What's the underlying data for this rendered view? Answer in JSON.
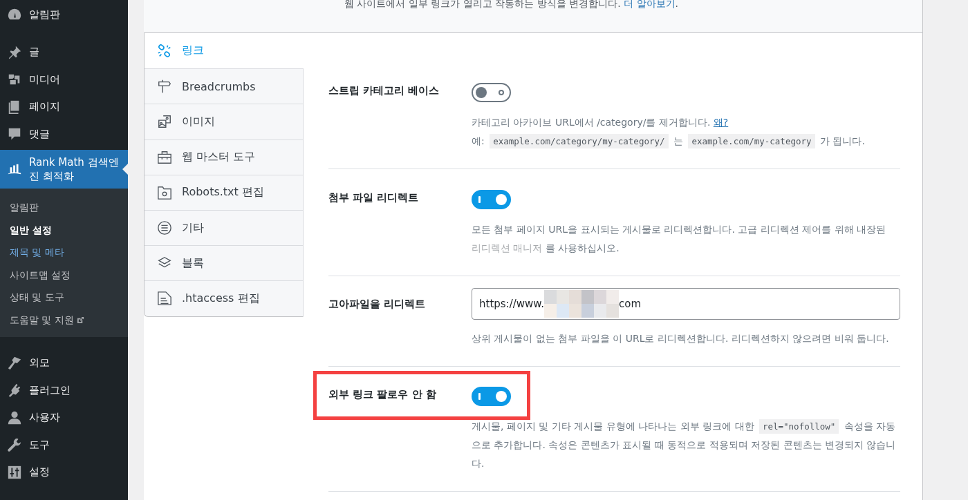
{
  "sidebar": {
    "items": [
      {
        "label": "알림판",
        "selected": false
      },
      {
        "label": "글",
        "selected": false
      },
      {
        "label": "미디어",
        "selected": false
      },
      {
        "label": "페이지",
        "selected": false
      },
      {
        "label": "댓글",
        "selected": false
      },
      {
        "label": "Rank Math 검색엔진 최적화",
        "selected": true,
        "children": [
          {
            "label": "알림판",
            "selected": false,
            "current": false
          },
          {
            "label": "일반 설정",
            "selected": true,
            "current": false
          },
          {
            "label": "제목 및 메타",
            "selected": false,
            "current": true
          },
          {
            "label": "사이트맵 설정",
            "selected": false,
            "current": false
          },
          {
            "label": "상태 및 도구",
            "selected": false,
            "current": false
          },
          {
            "label": "도움말 및 지원",
            "selected": false,
            "current": false,
            "external": true
          }
        ]
      },
      {
        "label": "외모",
        "selected": false
      },
      {
        "label": "플러그인",
        "selected": false
      },
      {
        "label": "사용자",
        "selected": false
      },
      {
        "label": "도구",
        "selected": false
      },
      {
        "label": "설정",
        "selected": false
      }
    ]
  },
  "header": {
    "description": "웹 사이트에서 일부 링크가 열리고 작동하는 방식을 변경합니다.",
    "link": "더 알아보기",
    "end": "."
  },
  "tabs": [
    {
      "label": "링크",
      "selected": true
    },
    {
      "label": "Breadcrumbs",
      "selected": false
    },
    {
      "label": "이미지",
      "selected": false
    },
    {
      "label": "웹 마스터 도구",
      "selected": false
    },
    {
      "label": "Robots.txt 편집",
      "selected": false
    },
    {
      "label": "기타",
      "selected": false
    },
    {
      "label": "블록",
      "selected": false
    },
    {
      "label": ".htaccess 편집",
      "selected": false
    }
  ],
  "settings": [
    {
      "label": "스트립 카테고리 베이스",
      "kind": "toggle",
      "on": false,
      "highlighted": false,
      "description": [
        [
          {
            "kind": "text",
            "text": "카테고리 아카이브 URL에서 /category/를 제거합니다."
          },
          {
            "kind": "link",
            "text": "왜?"
          }
        ],
        [
          {
            "kind": "text",
            "text": "예:"
          },
          {
            "kind": "code",
            "text": "example.com/category/my-category/"
          },
          {
            "kind": "text",
            "text": "는"
          },
          {
            "kind": "code",
            "text": "example.com/my-category"
          },
          {
            "kind": "text",
            "text": "가 됩니다."
          }
        ]
      ]
    },
    {
      "label": "첨부 파일 리디렉트",
      "kind": "toggle",
      "on": true,
      "highlighted": false,
      "description": [
        [
          {
            "kind": "text",
            "text": "모든 첨부 페이지 URL을 표시되는 게시물로 리디렉션합니다. 고급 리디렉션 제어를 위해 내장된 "
          },
          {
            "kind": "muted-link",
            "text": "리디렉션 매니저"
          },
          {
            "kind": "text",
            "text": "를 사용하십시오."
          }
        ]
      ]
    },
    {
      "label": "고아파일을 리디렉트",
      "kind": "field",
      "value": "https://www.",
      "value_end": "com",
      "highlighted": false,
      "description": [
        [
          {
            "kind": "text",
            "text": "상위 게시물이 없는 첨부 파일을 이 URL로 리디렉션합니다. 리디렉션하지 않으려면 비워 둡니다."
          }
        ]
      ]
    },
    {
      "label": "외부 링크 팔로우 안 함",
      "kind": "toggle",
      "on": true,
      "highlighted": true,
      "description": [
        [
          {
            "kind": "text",
            "text": "게시물, 페이지 및 기타 게시물 유형에 나타나는 외부 링크에 대한"
          },
          {
            "kind": "code",
            "text": "rel=\"nofollow\""
          },
          {
            "kind": "text",
            "text": "속성을 자동으로 추가합니다. 속성은 콘텐츠가 표시될 때 동적으로 적용되며 저장된 콘텐츠는 변경되지 않습니다."
          }
        ]
      ]
    }
  ]
}
